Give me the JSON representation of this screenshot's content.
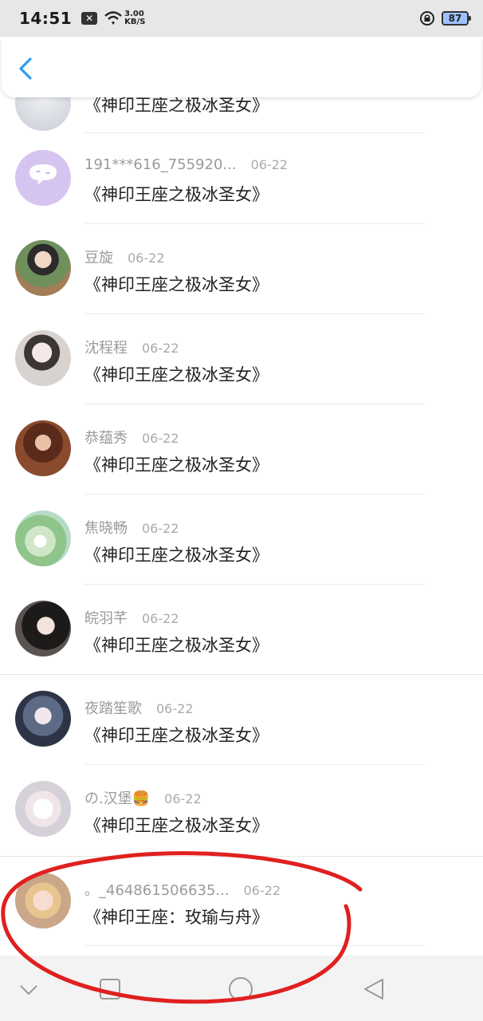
{
  "status_bar": {
    "time": "14:51",
    "net_speed_value": "3.00",
    "net_speed_unit": "KB/S",
    "battery": "87"
  },
  "header": {
    "back_icon": "chevron-left-icon",
    "accent_color": "#2f9bf2"
  },
  "partial_row": {
    "title": "《神印王座之极冰圣女》"
  },
  "rows": [
    {
      "name": "191***616_755920...",
      "date": "06-22",
      "title": "《神印王座之极冰圣女》",
      "avatar": "wechat-bubble-avatar"
    },
    {
      "name": "豆旋",
      "date": "06-22",
      "title": "《神印王座之极冰圣女》",
      "avatar": "photo-avatar"
    },
    {
      "name": "沈程程",
      "date": "06-22",
      "title": "《神印王座之极冰圣女》",
      "avatar": "photo-avatar"
    },
    {
      "name": "恭蕴秀",
      "date": "06-22",
      "title": "《神印王座之极冰圣女》",
      "avatar": "photo-avatar"
    },
    {
      "name": "焦晓畅",
      "date": "06-22",
      "title": "《神印王座之极冰圣女》",
      "avatar": "dandelion-avatar"
    },
    {
      "name": "皖羽芊",
      "date": "06-22",
      "title": "《神印王座之极冰圣女》",
      "avatar": "photo-avatar"
    },
    {
      "name": "夜踏笙歌",
      "date": "06-22",
      "title": "《神印王座之极冰圣女》",
      "avatar": "anime-avatar"
    },
    {
      "name": "の.汉堡🍔",
      "date": "06-22",
      "title": "《神印王座之极冰圣女》",
      "avatar": "anime-avatar"
    },
    {
      "name": "。_464861506635...",
      "date": "06-22",
      "title": "《神印王座：玫瑜与舟》",
      "avatar": "anime-avatar"
    }
  ],
  "nav": {
    "back_icon": "triangle-back-icon",
    "home_icon": "circle-home-icon",
    "recent_icon": "square-recent-icon",
    "hide_icon": "chevron-down-icon"
  },
  "annotation_color": "#e02020"
}
